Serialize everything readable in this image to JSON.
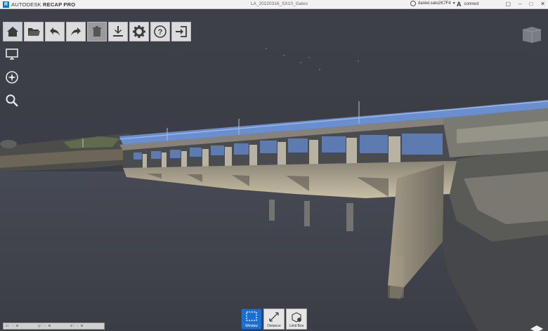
{
  "app": {
    "brand_prefix": "AUTODESK",
    "brand_name": "RECAP PRO",
    "document_title": "LA_20220316_SX10_Gates"
  },
  "user": {
    "name": "daniel.sato2K7F4"
  },
  "connect": {
    "label": "connect"
  },
  "toolbar": {
    "items": [
      "home",
      "open",
      "undo",
      "redo",
      "delete",
      "export",
      "settings",
      "help",
      "exit"
    ]
  },
  "side_tools": [
    "display",
    "navigate",
    "zoom"
  ],
  "bottom_tools": {
    "window_label": "Window",
    "distance_label": "Distance",
    "limit_box_label": "Limit Box"
  },
  "coordinates": {
    "x": "x: - m",
    "y": "y: - m",
    "z": "z: - m"
  },
  "colors": {
    "accent": "#1b6fd1",
    "viewport_bg": "#3b3e45",
    "toolbar_bg": "#dcdcdc"
  }
}
